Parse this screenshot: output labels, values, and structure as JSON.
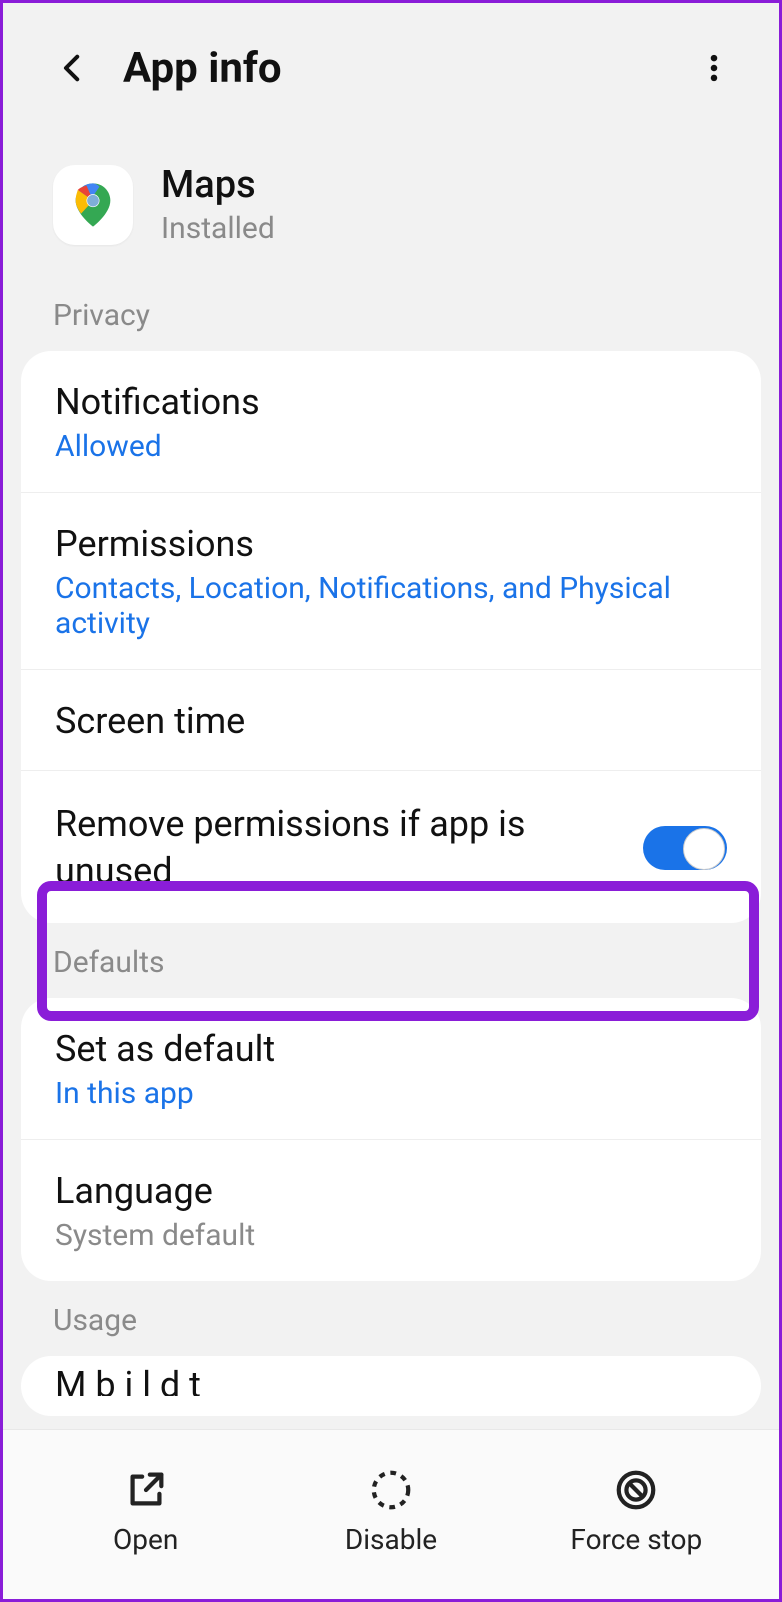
{
  "header": {
    "title": "App info"
  },
  "app": {
    "name": "Maps",
    "status": "Installed"
  },
  "sections": {
    "privacy": {
      "label": "Privacy",
      "notifications": {
        "title": "Notifications",
        "value": "Allowed"
      },
      "permissions": {
        "title": "Permissions",
        "value": "Contacts, Location, Notifications, and Physical activity"
      },
      "screen_time": {
        "title": "Screen time"
      },
      "remove_perm": {
        "title": "Remove permissions if app is unused",
        "toggle": true
      }
    },
    "defaults": {
      "label": "Defaults",
      "set_default": {
        "title": "Set as default",
        "value": "In this app"
      },
      "language": {
        "title": "Language",
        "value": "System default"
      }
    },
    "usage": {
      "label": "Usage",
      "mobile_data": {
        "title_partial": "Mobile data"
      }
    }
  },
  "bottom": {
    "open": "Open",
    "disable": "Disable",
    "force_stop": "Force stop"
  },
  "icons": {
    "back": "back-icon",
    "more": "more-vertical-icon",
    "maps": "google-maps-icon",
    "open": "open-external-icon",
    "disable": "dashed-circle-icon",
    "force_stop": "prohibit-icon"
  }
}
